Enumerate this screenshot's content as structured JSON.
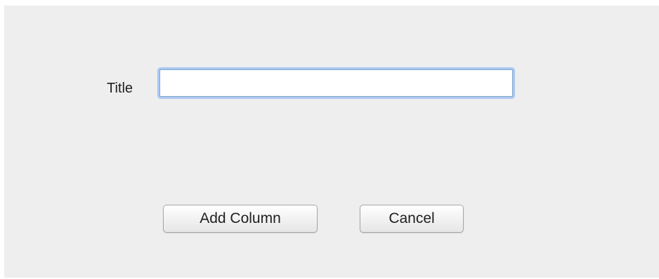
{
  "form": {
    "title_label": "Title",
    "title_value": "",
    "title_placeholder": ""
  },
  "buttons": {
    "add_label": "Add Column",
    "cancel_label": "Cancel"
  },
  "colors": {
    "dialog_background": "#eeeeee",
    "focus_ring": "#a8c8f2"
  }
}
